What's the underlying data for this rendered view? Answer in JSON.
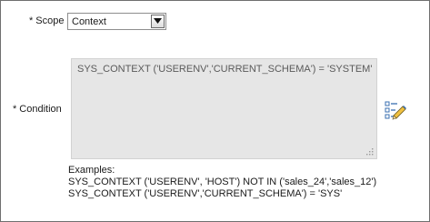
{
  "scope": {
    "required_marker": "*",
    "label": "Scope",
    "selected_value": "Context"
  },
  "condition": {
    "required_marker": "*",
    "label": "Condition",
    "value": "SYS_CONTEXT ('USERENV','CURRENT_SCHEMA') = 'SYSTEM'"
  },
  "examples": {
    "heading": "Examples:",
    "lines": [
      "SYS_CONTEXT ('USERENV', 'HOST') NOT IN ('sales_24','sales_12')",
      "SYS_CONTEXT ('USERENV','CURRENT_SCHEMA') = 'SYS'"
    ]
  },
  "icons": {
    "dropdown": "chevron-down-icon",
    "editor": "expression-builder-icon",
    "resize": "resize-grip-icon"
  }
}
